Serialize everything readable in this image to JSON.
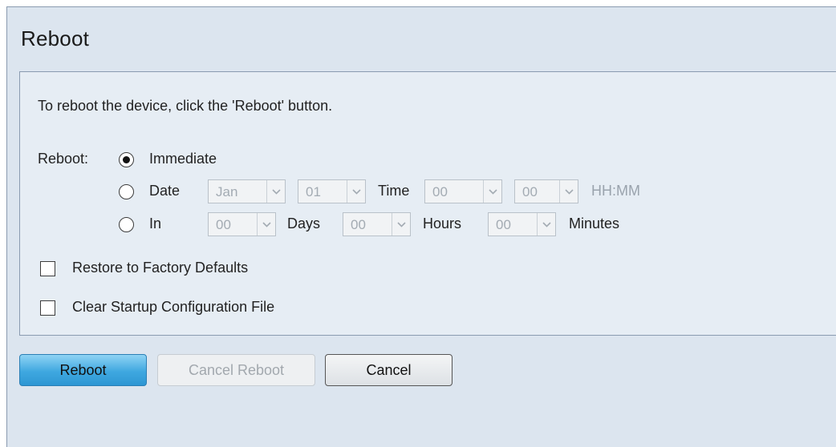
{
  "page": {
    "title": "Reboot"
  },
  "instructions": "To reboot the device, click the 'Reboot' button.",
  "reboot": {
    "label": "Reboot:",
    "options": {
      "immediate": {
        "label": "Immediate",
        "selected": true
      },
      "date": {
        "label": "Date",
        "selected": false,
        "month": "Jan",
        "day": "01",
        "time_label": "Time",
        "hour": "00",
        "minute": "00",
        "format_hint": "HH:MM"
      },
      "in": {
        "label": "In",
        "selected": false,
        "days": "00",
        "days_label": "Days",
        "hours": "00",
        "hours_label": "Hours",
        "minutes": "00",
        "minutes_label": "Minutes"
      }
    }
  },
  "checkboxes": {
    "restore_defaults": {
      "label": "Restore to Factory Defaults",
      "checked": false
    },
    "clear_startup": {
      "label": "Clear Startup Configuration File",
      "checked": false
    }
  },
  "buttons": {
    "reboot": "Reboot",
    "cancel_reboot": "Cancel Reboot",
    "cancel": "Cancel"
  },
  "icons": {
    "dropdown": "chevron-down-icon"
  },
  "colors": {
    "primary_button": "#3fa8e0",
    "panel_background": "#e6edf4",
    "frame_background": "#dce5ef"
  }
}
